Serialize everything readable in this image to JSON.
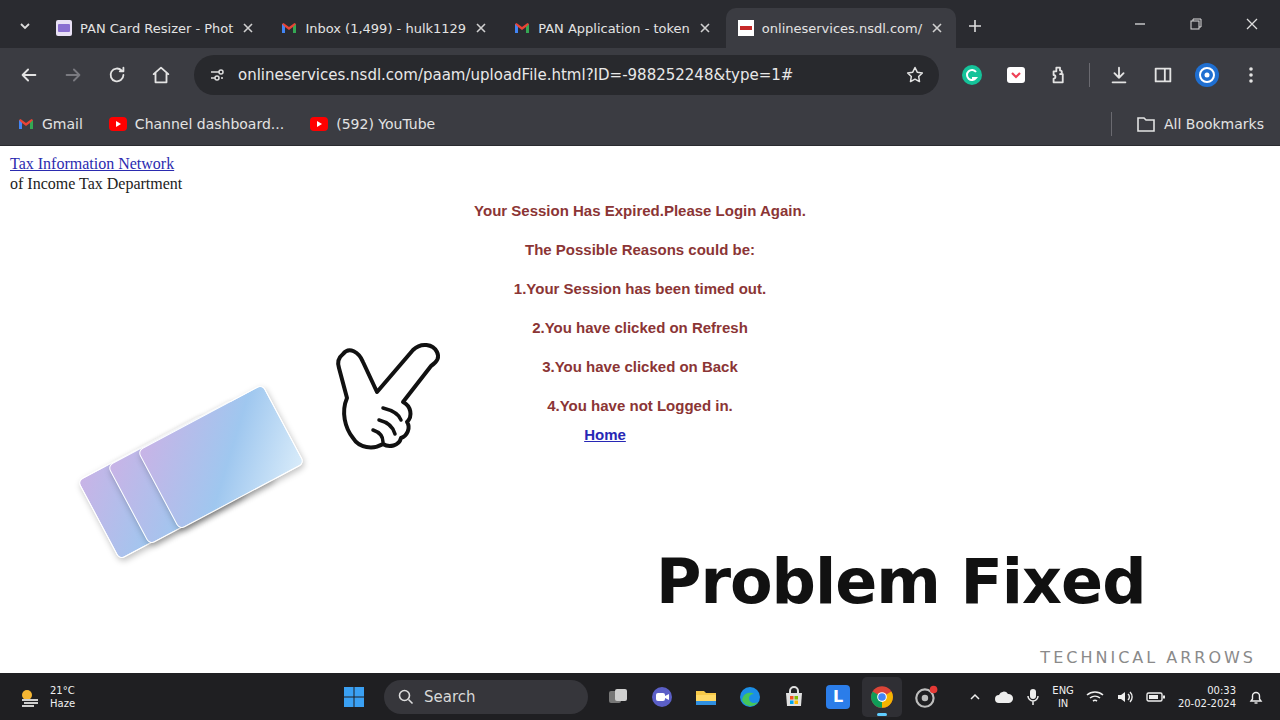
{
  "window": {
    "tabs": [
      {
        "label": "PAN Card Resizer - Phot",
        "kind": "pan",
        "selected": false
      },
      {
        "label": "Inbox (1,499) - hulk1129",
        "kind": "gmail",
        "selected": false
      },
      {
        "label": "PAN Application - token",
        "kind": "gmail",
        "selected": false
      },
      {
        "label": "onlineservices.nsdl.com/",
        "kind": "nsdl",
        "selected": true
      }
    ],
    "address": "onlineservices.nsdl.com/paam/uploadFile.html?ID=-988252248&type=1#",
    "bookmarks": [
      {
        "label": "Gmail",
        "kind": "gmail"
      },
      {
        "label": "Channel dashboard...",
        "kind": "youtube"
      },
      {
        "label": "(592) YouTube",
        "kind": "youtube"
      }
    ],
    "all_bookmarks": "All Bookmarks"
  },
  "page": {
    "header_link": "Tax Information Network",
    "header_sub": "of Income Tax Department",
    "title": "Your Session Has Expired.Please Login Again.",
    "reasons_heading": "The Possible Reasons could be:",
    "reasons": [
      "1.Your Session has been timed out.",
      "2.You have clicked on Refresh",
      "3.You have clicked on Back",
      "4.You have not Logged in."
    ],
    "home_link": "Home"
  },
  "overlay": {
    "caption": "Problem Fixed",
    "watermark": "TECHNICAL ARROWS"
  },
  "taskbar": {
    "weather": {
      "temperature": "21°C",
      "condition": "Haze"
    },
    "search": {
      "placeholder": "Search"
    },
    "apps": [
      {
        "kind": "taskview",
        "selected": false,
        "badge": ""
      },
      {
        "kind": "meet",
        "selected": false,
        "badge": ""
      },
      {
        "kind": "files",
        "selected": false,
        "badge": ""
      },
      {
        "kind": "edge",
        "selected": false,
        "badge": ""
      },
      {
        "kind": "store",
        "selected": false,
        "badge": ""
      },
      {
        "kind": "letter",
        "selected": false,
        "badge": "L"
      },
      {
        "kind": "chrome",
        "selected": true,
        "badge": ""
      },
      {
        "kind": "recorder",
        "selected": false,
        "badge": ""
      }
    ],
    "language": "ENG",
    "region": "IN",
    "time": "00:33",
    "date": "20-02-2024"
  }
}
